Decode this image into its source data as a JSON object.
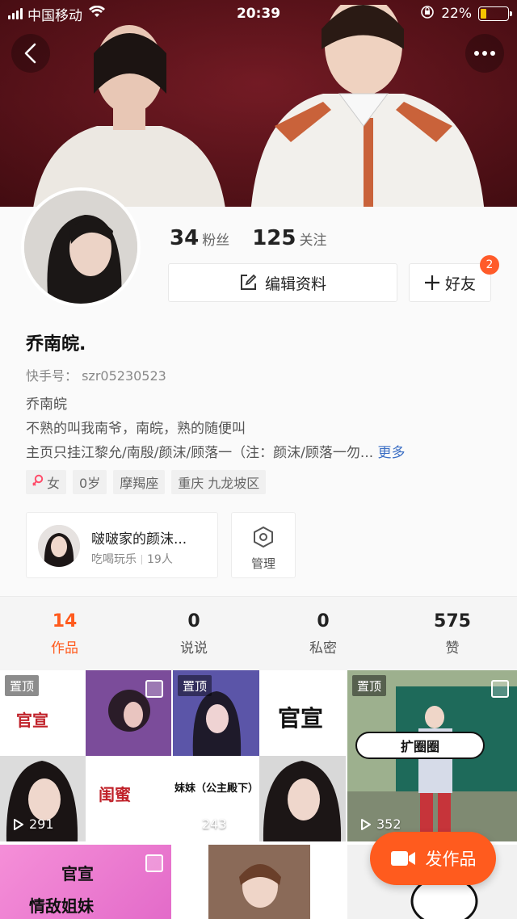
{
  "status_bar": {
    "carrier": "中国移动",
    "time": "20:39",
    "battery_text": "22%",
    "battery_level": 0.22
  },
  "profile": {
    "followers_count": "34",
    "followers_label": "粉丝",
    "following_count": "125",
    "following_label": "关注",
    "edit_label": "编辑资料",
    "add_friend_label": "好友",
    "friend_badge": "2",
    "name": "乔南皖.",
    "kuaishou_id": "快手号：   szr05230523",
    "bio_lines": [
      "乔南皖",
      "不熟的叫我南爷，南皖，熟的随便叫",
      "主页只挂江黎允/南殷/颜沫/顾落一（注：颜沫/顾落一勿..."
    ],
    "bio_more": "更多",
    "tags": [
      "女",
      "0岁",
      "摩羯座",
      "重庆 九龙坡区"
    ]
  },
  "group": {
    "name": "啵啵家的颜沫...",
    "category": "吃喝玩乐",
    "members": "19人",
    "manage_label": "管理"
  },
  "tabs": [
    {
      "count": "14",
      "label": "作品",
      "active": true
    },
    {
      "count": "0",
      "label": "说说",
      "active": false
    },
    {
      "count": "0",
      "label": "私密",
      "active": false
    },
    {
      "count": "575",
      "label": "赞",
      "active": false
    }
  ],
  "grid": {
    "pin_label": "置顶",
    "items": [
      {
        "title": "官宣",
        "subtitle": "闺蜜",
        "plays": "291"
      },
      {
        "title": "官宣",
        "subtitle": "妹妹（公主殿下）",
        "plays": "243"
      },
      {
        "title": "扩圈圈",
        "plays": "352"
      },
      {
        "title": "官宣",
        "subtitle": "情敌姐妹"
      }
    ]
  },
  "fab_label": "发作品",
  "colors": {
    "accent": "#ff5b1e",
    "link": "#3b6ec4"
  }
}
